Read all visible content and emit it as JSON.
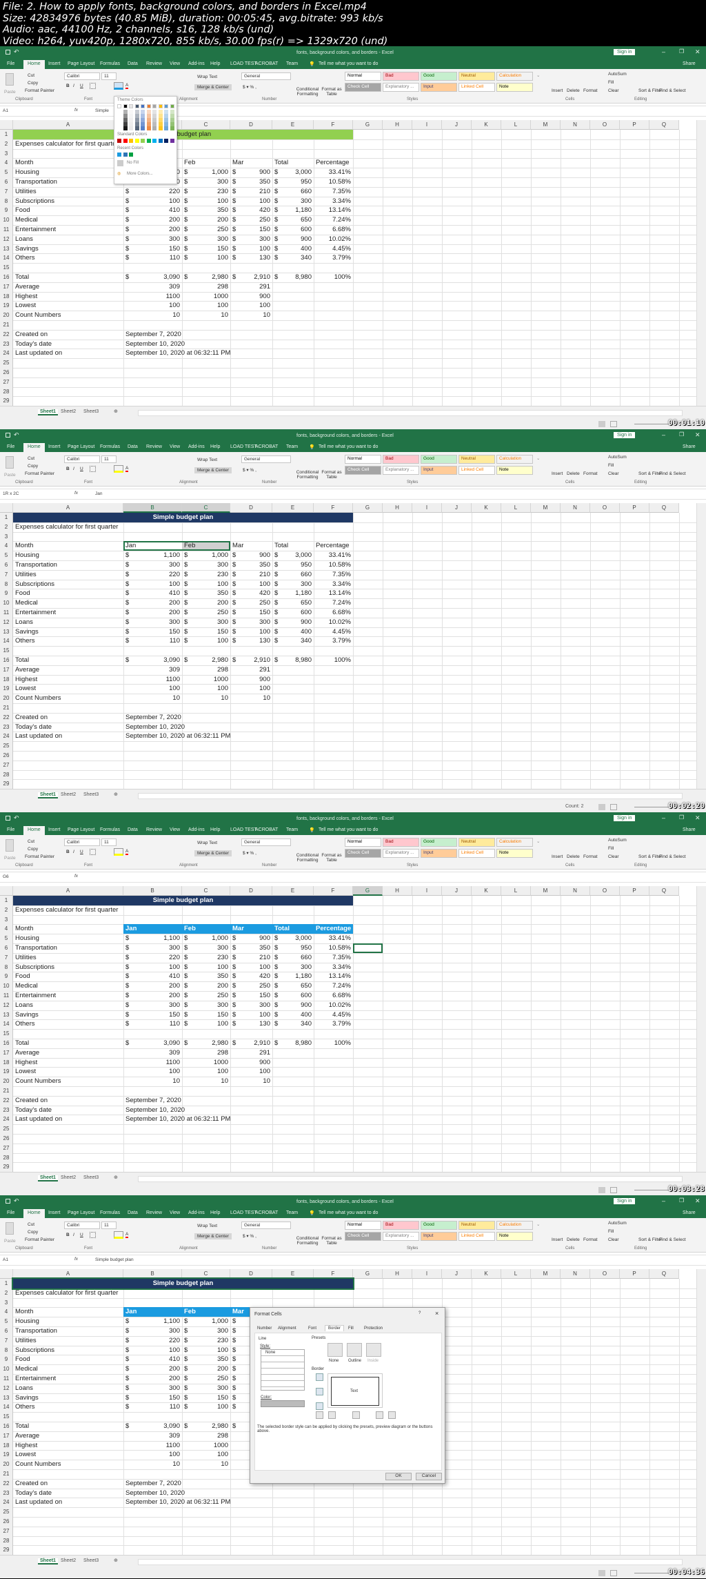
{
  "info": {
    "lines": [
      "File: 2. How to apply fonts, background colors, and borders in Excel.mp4",
      "Size: 42834976 bytes (40.85 MiB), duration: 00:05:45, avg.bitrate: 993 kb/s",
      "Audio: aac, 44100 Hz, 2 channels, s16, 128 kb/s (und)",
      "Video: h264, yuv420p, 1280x720, 855 kb/s, 30.00 fps(r) => 1329x720 (und)"
    ]
  },
  "app": {
    "title": "fonts, background colors, and borders - Excel",
    "sign_in": "Sign in",
    "share": "Share",
    "tell_me": "Tell me what you want to do",
    "tabs": [
      "File",
      "Home",
      "Insert",
      "Page Layout",
      "Formulas",
      "Data",
      "Review",
      "View",
      "Add-ins",
      "Help",
      "LOAD TEST",
      "ACROBAT",
      "Team"
    ],
    "ribbon": {
      "paste": "Paste",
      "cut": "Cut",
      "copy": "Copy",
      "format_painter": "Format Painter",
      "font": "Calibri",
      "size": "11",
      "wrap": "Wrap Text",
      "merge": "Merge & Center",
      "number_format": "General",
      "cond": "Conditional Formatting",
      "fat": "Format as Table",
      "styles": [
        {
          "label": "Normal",
          "bg": "#ffffff",
          "fg": "#000000"
        },
        {
          "label": "Bad",
          "bg": "#ffc7ce",
          "fg": "#9c0006"
        },
        {
          "label": "Good",
          "bg": "#c6efce",
          "fg": "#006100"
        },
        {
          "label": "Neutral",
          "bg": "#ffeb9c",
          "fg": "#9c5700"
        },
        {
          "label": "Calculation",
          "bg": "#f2f2f2",
          "fg": "#fa7d00"
        },
        {
          "label": "Check Cell",
          "bg": "#a5a5a5",
          "fg": "#ffffff"
        },
        {
          "label": "Explanatory ...",
          "bg": "#ffffff",
          "fg": "#7f7f7f"
        },
        {
          "label": "Input",
          "bg": "#ffcc99",
          "fg": "#3f3f76"
        },
        {
          "label": "Linked Cell",
          "bg": "#ffffff",
          "fg": "#fa7d00"
        },
        {
          "label": "Note",
          "bg": "#ffffcc",
          "fg": "#000000"
        }
      ],
      "insert": "Insert",
      "delete": "Delete",
      "format": "Format",
      "autosum": "AutoSum",
      "fill": "Fill",
      "clear": "Clear",
      "sort": "Sort & Filter",
      "find": "Find & Select",
      "groups": [
        "Clipboard",
        "Font",
        "Alignment",
        "Number",
        "Styles",
        "Cells",
        "Editing"
      ]
    },
    "columns": [
      "A",
      "B",
      "C",
      "D",
      "E",
      "F",
      "G",
      "H",
      "I",
      "J",
      "K",
      "L",
      "M",
      "N",
      "O",
      "P",
      "Q"
    ],
    "sheets": [
      "Sheet1",
      "Sheet2",
      "Sheet3"
    ]
  },
  "sheet": {
    "title": "Simple budget plan",
    "subtitle": "Expenses calculator for first quarter",
    "header": [
      "Month",
      "Jan",
      "Feb",
      "Mar",
      "Total",
      "Percentage"
    ],
    "rows": [
      [
        "Housing",
        "1,100",
        "1,000",
        "900",
        "3,000",
        "33.41%"
      ],
      [
        "Transportation",
        "300",
        "300",
        "350",
        "950",
        "10.58%"
      ],
      [
        "Utilities",
        "220",
        "230",
        "210",
        "660",
        "7.35%"
      ],
      [
        "Subscriptions",
        "100",
        "100",
        "100",
        "300",
        "3.34%"
      ],
      [
        "Food",
        "410",
        "350",
        "420",
        "1,180",
        "13.14%"
      ],
      [
        "Medical",
        "200",
        "200",
        "250",
        "650",
        "7.24%"
      ],
      [
        "Entertainment",
        "200",
        "250",
        "150",
        "600",
        "6.68%"
      ],
      [
        "Loans",
        "300",
        "300",
        "300",
        "900",
        "10.02%"
      ],
      [
        "Savings",
        "150",
        "150",
        "100",
        "400",
        "4.45%"
      ],
      [
        "Others",
        "110",
        "100",
        "130",
        "340",
        "3.79%"
      ]
    ],
    "total": [
      "Total",
      "3,090",
      "2,980",
      "2,910",
      "8,980",
      "100%"
    ],
    "stats": [
      [
        "Average",
        "309",
        "298",
        "291"
      ],
      [
        "Highest",
        "1100",
        "1000",
        "900"
      ],
      [
        "Lowest",
        "100",
        "100",
        "100"
      ],
      [
        "Count Numbers",
        "10",
        "10",
        "10"
      ]
    ],
    "dates": [
      [
        "Created on",
        "September 7, 2020"
      ],
      [
        "Today's date",
        "September 10, 2020"
      ],
      [
        "Last updated on",
        "September 10, 2020 at 06:32:11 PM"
      ]
    ],
    "currency": "$"
  },
  "colors": {
    "excel_green": "#217346",
    "title_green": "#92d050",
    "title_navy": "#1f3864",
    "header_blue": "#1b9be0"
  },
  "frames": [
    {
      "namebox": "A1",
      "formula": "Simple",
      "timestamp": "00:01:10",
      "status": "",
      "style": "green"
    },
    {
      "namebox": "1R x 2C",
      "formula": "Jan",
      "timestamp": "00:02:20",
      "status": "Count: 2",
      "style": "navy"
    },
    {
      "namebox": "G6",
      "formula": "",
      "timestamp": "00:03:28",
      "status": "",
      "style": "blue"
    },
    {
      "namebox": "A1",
      "formula": "Simple budget plan",
      "timestamp": "00:04:36",
      "status": "",
      "style": "blue"
    }
  ],
  "color_popup": {
    "theme": "Theme Colors",
    "standard": "Standard Colors",
    "recent": "Recent Colors",
    "no_fill": "No Fill",
    "more": "More Colors...",
    "theme_colors": [
      "#ffffff",
      "#000000",
      "#e7e6e6",
      "#44546a",
      "#4472c4",
      "#ed7d31",
      "#a5a5a5",
      "#ffc000",
      "#5b9bd5",
      "#70ad47"
    ],
    "standard_colors": [
      "#c00000",
      "#ff0000",
      "#ffc000",
      "#ffff00",
      "#92d050",
      "#00b050",
      "#00b0f0",
      "#0070c0",
      "#002060",
      "#7030a0"
    ],
    "recent_colors": [
      "#1b9be0",
      "#2e75b6",
      "#00a040"
    ]
  },
  "dialog": {
    "title": "Format Cells",
    "help": "?",
    "close": "×",
    "tabs": [
      "Number",
      "Alignment",
      "Font",
      "Border",
      "Fill",
      "Protection"
    ],
    "line": "Line",
    "style": "Style:",
    "none": "None",
    "color": "Color:",
    "presets": "Presets",
    "preset_labels": [
      "None",
      "Outline",
      "Inside"
    ],
    "border": "Border",
    "text": "Text",
    "note": "The selected border style can be applied by clicking the presets, preview diagram or the buttons above.",
    "ok": "OK",
    "cancel": "Cancel"
  }
}
